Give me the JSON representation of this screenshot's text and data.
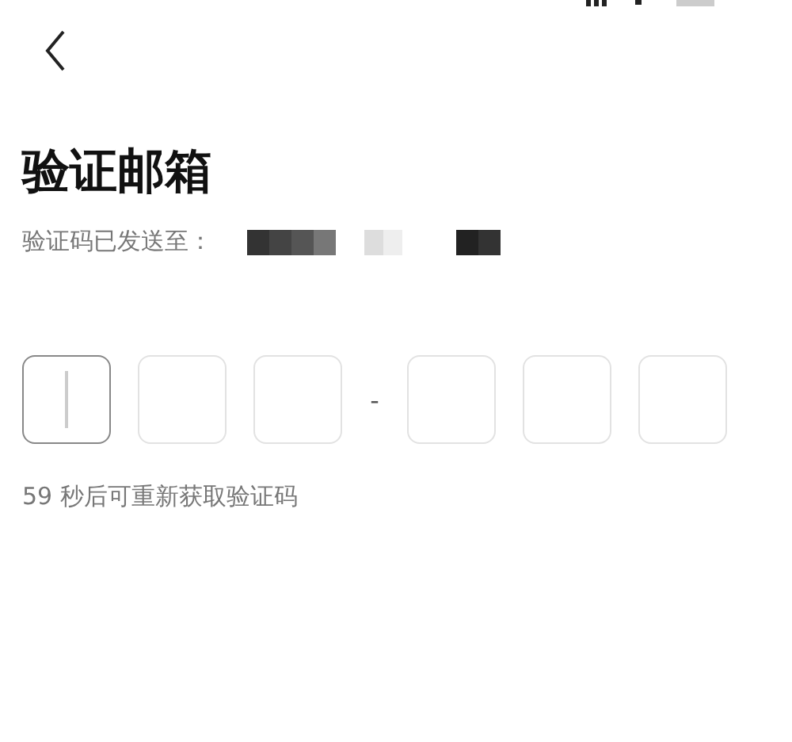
{
  "title": "验证邮箱",
  "subtitle": {
    "label": "验证码已发送至：",
    "email": {
      "kind": "redacted"
    }
  },
  "code_boxes": [
    {
      "focused": true
    },
    {
      "focused": false
    },
    {
      "focused": false
    },
    {
      "focused": false
    },
    {
      "focused": false
    },
    {
      "focused": false
    }
  ],
  "separator": "-",
  "countdown": "59 秒后可重新获取验证码"
}
